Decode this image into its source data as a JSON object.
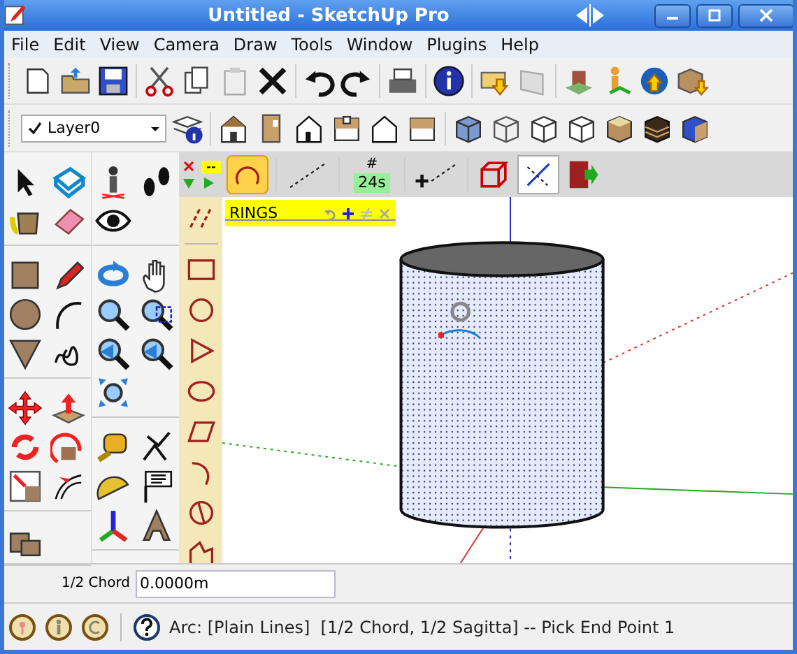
{
  "window": {
    "title": "Untitled - SketchUp Pro"
  },
  "menu": [
    {
      "label": "File"
    },
    {
      "label": "Edit"
    },
    {
      "label": "View"
    },
    {
      "label": "Camera"
    },
    {
      "label": "Draw"
    },
    {
      "label": "Tools"
    },
    {
      "label": "Window"
    },
    {
      "label": "Plugins"
    },
    {
      "label": "Help"
    }
  ],
  "layer_select": {
    "value": "Layer0"
  },
  "rings_toolbar": {
    "dash_label": "--",
    "segments_symbol": "#",
    "segments_value": "24s"
  },
  "rings_panel": {
    "title": "RINGS"
  },
  "measurements": {
    "label": "1/2 Chord",
    "value": "0.0000m"
  },
  "status_bar": {
    "text": "Arc: [Plain Lines]  [1/2 Chord, 1/2 Sagitta] -- Pick End Point 1"
  }
}
